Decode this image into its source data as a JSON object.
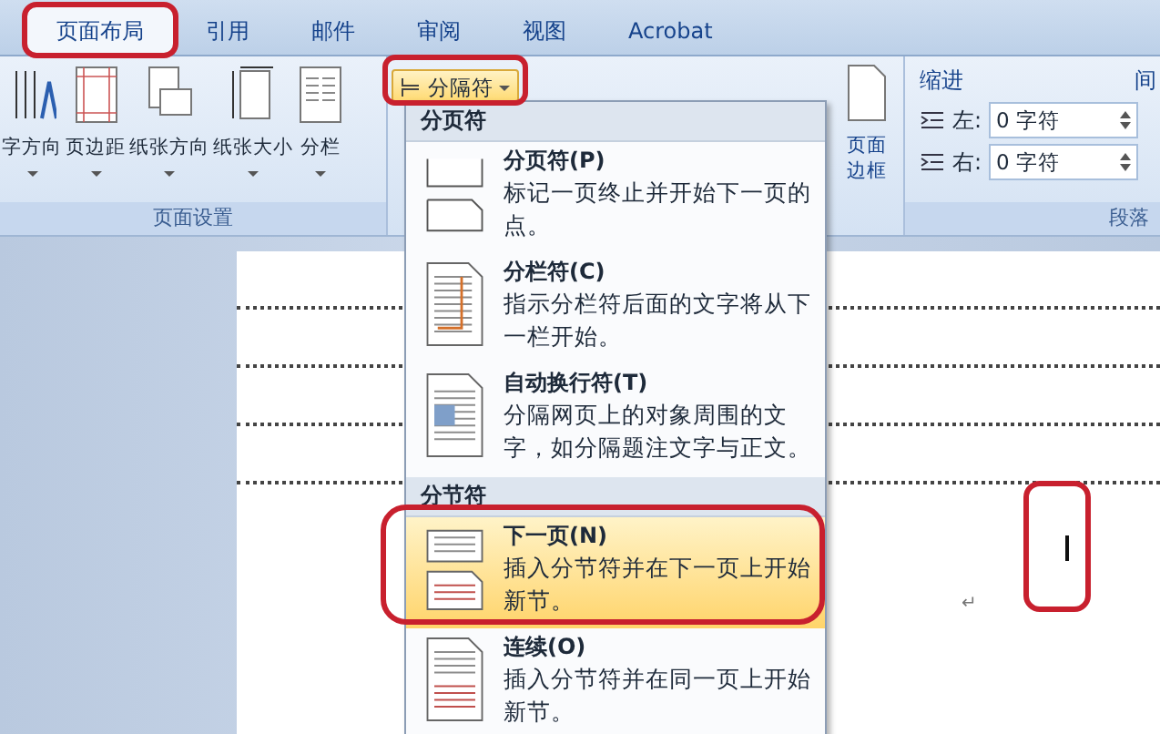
{
  "tabs": [
    {
      "label": "页面布局",
      "selected": true,
      "circled": true
    },
    {
      "label": "引用",
      "selected": false,
      "circled": false
    },
    {
      "label": "邮件",
      "selected": false,
      "circled": false
    },
    {
      "label": "审阅",
      "selected": false,
      "circled": false
    },
    {
      "label": "视图",
      "selected": false,
      "circled": false
    },
    {
      "label": "Acrobat",
      "selected": false,
      "circled": false
    }
  ],
  "ribbon": {
    "page_setup": {
      "title": "页面设置",
      "buttons": [
        {
          "label": "字方向",
          "kind": "direction"
        },
        {
          "label": "页边距",
          "kind": "margins"
        },
        {
          "label": "纸张方向",
          "kind": "orientation"
        },
        {
          "label": "纸张大小",
          "kind": "size"
        },
        {
          "label": "分栏",
          "kind": "columns"
        }
      ]
    },
    "breaks_button": {
      "label": "分隔符",
      "circled": true
    },
    "page_border": {
      "lines": [
        "页面",
        "边框"
      ]
    },
    "paragraph": {
      "title": "段落",
      "indent_label": "缩进",
      "indents": [
        {
          "label": "左:",
          "value": "0 字符"
        },
        {
          "label": "右:",
          "value": "0 字符"
        }
      ],
      "spacing_label": "间"
    }
  },
  "menu": {
    "sections": [
      {
        "title": "分页符",
        "items": [
          {
            "kind": "page",
            "title": "分页符(P)",
            "description": "标记一页终止并开始下一页的点。",
            "selected": false,
            "circled": false
          },
          {
            "kind": "column",
            "title": "分栏符(C)",
            "description": "指示分栏符后面的文字将从下一栏开始。",
            "selected": false,
            "circled": false
          },
          {
            "kind": "wrap",
            "title": "自动换行符(T)",
            "description": "分隔网页上的对象周围的文字，如分隔题注文字与正文。",
            "selected": false,
            "circled": false
          }
        ]
      },
      {
        "title": "分节符",
        "items": [
          {
            "kind": "next",
            "title": "下一页(N)",
            "description": "插入分节符并在下一页上开始新节。",
            "selected": true,
            "circled": true
          },
          {
            "kind": "continuous",
            "title": "连续(O)",
            "description": "插入分节符并在同一页上开始新节。",
            "selected": false,
            "circled": false
          }
        ]
      }
    ]
  },
  "document": {
    "paragraph_mark": "↵",
    "cursor_circled": true
  }
}
